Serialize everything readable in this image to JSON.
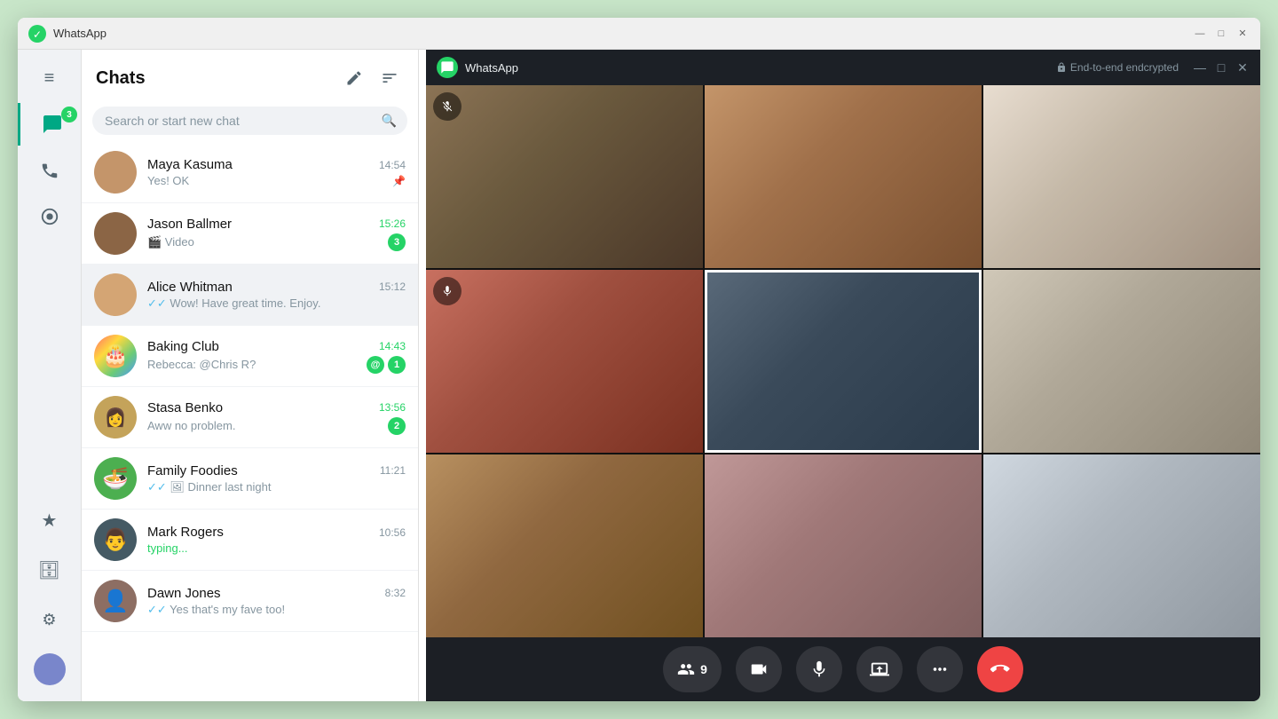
{
  "app": {
    "title": "WhatsApp",
    "encryption_label": "End-to-end endcrypted",
    "logo_icon": "💬"
  },
  "titlebar": {
    "minimize": "—",
    "maximize": "□",
    "close": "✕"
  },
  "sidebar": {
    "chat_badge": "3",
    "items": [
      {
        "id": "menu",
        "icon": "≡",
        "label": "Menu"
      },
      {
        "id": "chats",
        "icon": "💬",
        "label": "Chats",
        "badge": "3",
        "active": true
      },
      {
        "id": "calls",
        "icon": "📞",
        "label": "Calls"
      },
      {
        "id": "status",
        "icon": "◎",
        "label": "Status"
      }
    ],
    "bottom_items": [
      {
        "id": "starred",
        "icon": "★",
        "label": "Starred"
      },
      {
        "id": "archive",
        "icon": "🗄",
        "label": "Archive"
      },
      {
        "id": "settings",
        "icon": "⚙",
        "label": "Settings"
      }
    ]
  },
  "chat_panel": {
    "title": "Chats",
    "new_chat_tooltip": "New chat",
    "filter_tooltip": "Filter",
    "search_placeholder": "Search or start new chat"
  },
  "chats": [
    {
      "id": "maya",
      "name": "Maya Kasuma",
      "preview": "Yes! OK",
      "time": "14:54",
      "time_green": false,
      "check": "pin",
      "unread": 0,
      "avatar_color": "#c4956a"
    },
    {
      "id": "jason",
      "name": "Jason Ballmer",
      "preview": "🎬 Video",
      "time": "15:26",
      "time_green": true,
      "check": "none",
      "unread": 3,
      "avatar_color": "#8b6545"
    },
    {
      "id": "alice",
      "name": "Alice Whitman",
      "preview": "✓✓ Wow! Have great time. Enjoy.",
      "time": "15:12",
      "time_green": false,
      "check": "double",
      "unread": 0,
      "active": true,
      "avatar_color": "#d4a574"
    },
    {
      "id": "baking",
      "name": "Baking Club",
      "preview": "Rebecca: @Chris R?",
      "time": "14:43",
      "time_green": true,
      "check": "none",
      "unread": 1,
      "mention": true,
      "avatar_color": "#ff6b6b"
    },
    {
      "id": "stasa",
      "name": "Stasa Benko",
      "preview": "Aww no problem.",
      "time": "13:56",
      "time_green": true,
      "check": "none",
      "unread": 2,
      "avatar_color": "#b8860b"
    },
    {
      "id": "family",
      "name": "Family Foodies",
      "preview": "✓✓ 🖼 Dinner last night",
      "time": "11:21",
      "time_green": false,
      "check": "double",
      "unread": 0,
      "avatar_color": "#4caf50"
    },
    {
      "id": "mark",
      "name": "Mark Rogers",
      "preview": "typing...",
      "time": "10:56",
      "time_green": false,
      "typing": true,
      "unread": 0,
      "avatar_color": "#455a64"
    },
    {
      "id": "dawn",
      "name": "Dawn Jones",
      "preview": "✓✓ Yes that's my fave too!",
      "time": "8:32",
      "time_green": false,
      "check": "double",
      "unread": 0,
      "avatar_color": "#8d6e63"
    }
  ],
  "video_call": {
    "participants_count": "9",
    "controls": [
      {
        "id": "participants",
        "label": "9",
        "icon": "👥"
      },
      {
        "id": "camera",
        "icon": "📹"
      },
      {
        "id": "mic",
        "icon": "🎤"
      },
      {
        "id": "screen",
        "icon": "📤"
      },
      {
        "id": "more",
        "icon": "•••"
      },
      {
        "id": "end",
        "icon": "📞"
      }
    ]
  }
}
